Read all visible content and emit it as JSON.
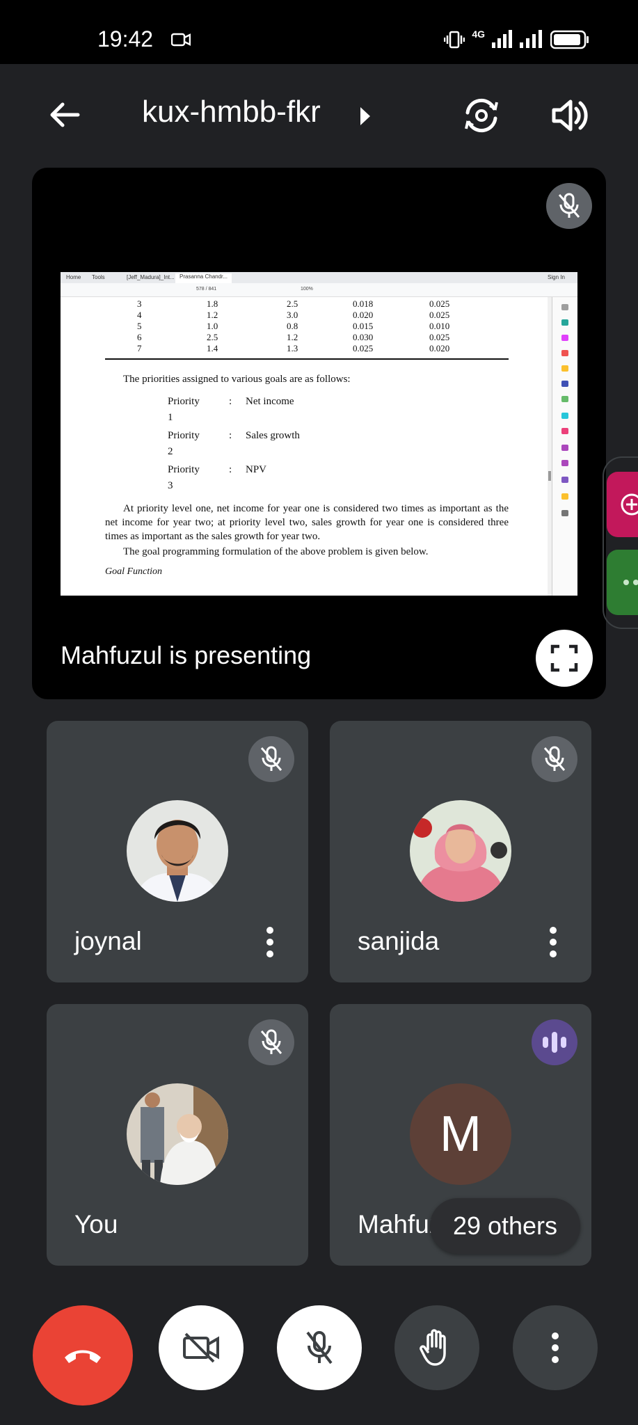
{
  "status_bar": {
    "time": "19:42",
    "network": "4G"
  },
  "header": {
    "meeting_code": "kux-hmbb-fkr"
  },
  "presentation": {
    "label": "Mahfuzul is presenting",
    "shared_screen": {
      "tabs": [
        "Home",
        "Tools",
        "[Jeff_Madura]_Int...",
        "Prasanna Chandr...",
        "Sign In"
      ],
      "page_indicator": "578 / 841",
      "zoom": "100%",
      "table_rows": [
        [
          "3",
          "1.8",
          "2.5",
          "0.018",
          "0.025"
        ],
        [
          "4",
          "1.2",
          "3.0",
          "0.020",
          "0.025"
        ],
        [
          "5",
          "1.0",
          "0.8",
          "0.015",
          "0.010"
        ],
        [
          "6",
          "2.5",
          "1.2",
          "0.030",
          "0.025"
        ],
        [
          "7",
          "1.4",
          "1.3",
          "0.025",
          "0.020"
        ]
      ],
      "intro": "The priorities assigned to various goals are as follows:",
      "priorities": [
        {
          "label": "Priority",
          "num": "1",
          "goal": "Net income"
        },
        {
          "label": "Priority",
          "num": "2",
          "goal": "Sales growth"
        },
        {
          "label": "Priority",
          "num": "3",
          "goal": "NPV"
        }
      ],
      "paragraph": "At priority level one, net income for year one is considered two times as important as the net income for year two; at priority level two, sales growth for year one is considered three times as important as the sales growth for year two.",
      "formulation": "The goal programming formulation of the above problem is given below.",
      "section": "Goal Function"
    }
  },
  "participants": [
    {
      "name": "joynal",
      "muted": true
    },
    {
      "name": "sanjida",
      "muted": true
    },
    {
      "name": "You",
      "muted": true
    },
    {
      "name": "Mahfuzul",
      "initial": "M",
      "speaking": true
    }
  ],
  "others_count": "29 others",
  "colors": {
    "end_call": "#ea4335",
    "tile_bg": "#3c4043",
    "page_bg": "#202124",
    "avatar_m": "#5d4037"
  }
}
